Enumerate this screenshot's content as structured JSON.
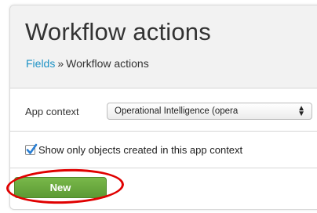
{
  "header": {
    "title": "Workflow actions",
    "breadcrumb": {
      "parent": "Fields",
      "separator": "»",
      "current": "Workflow actions"
    }
  },
  "app_context": {
    "label": "App context",
    "selected_value": "Operational Intelligence (opera",
    "arrow_icon": "up-down-arrows-icon"
  },
  "filter": {
    "checked": true,
    "label": "Show only objects created in this app context"
  },
  "actions": {
    "new_label": "New"
  },
  "colors": {
    "link": "#1e93c6",
    "button_green": "#65a33a",
    "highlight_red": "#e00000",
    "checkbox_blue": "#2a7fd4"
  }
}
